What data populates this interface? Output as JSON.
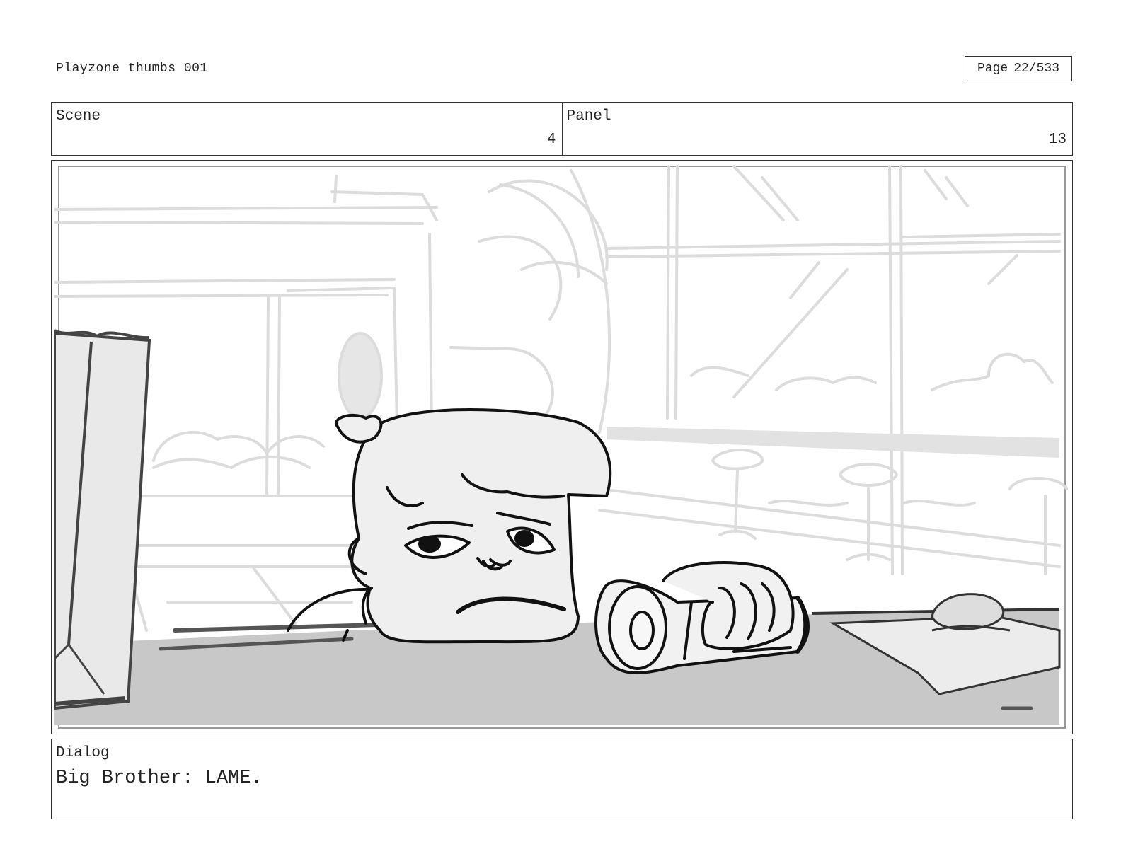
{
  "header": {
    "title": "Playzone thumbs 001",
    "page_label": "Page",
    "page_value": "22/533"
  },
  "info": {
    "scene_label": "Scene",
    "scene_value": "4",
    "panel_label": "Panel",
    "panel_value": "13"
  },
  "dialog": {
    "label": "Dialog",
    "text": "Big Brother: LAME."
  },
  "colors": {
    "border": "#333333",
    "sketch_light": "#dcdcdc",
    "table_gray": "#c8c8c8",
    "ink": "#111111"
  }
}
